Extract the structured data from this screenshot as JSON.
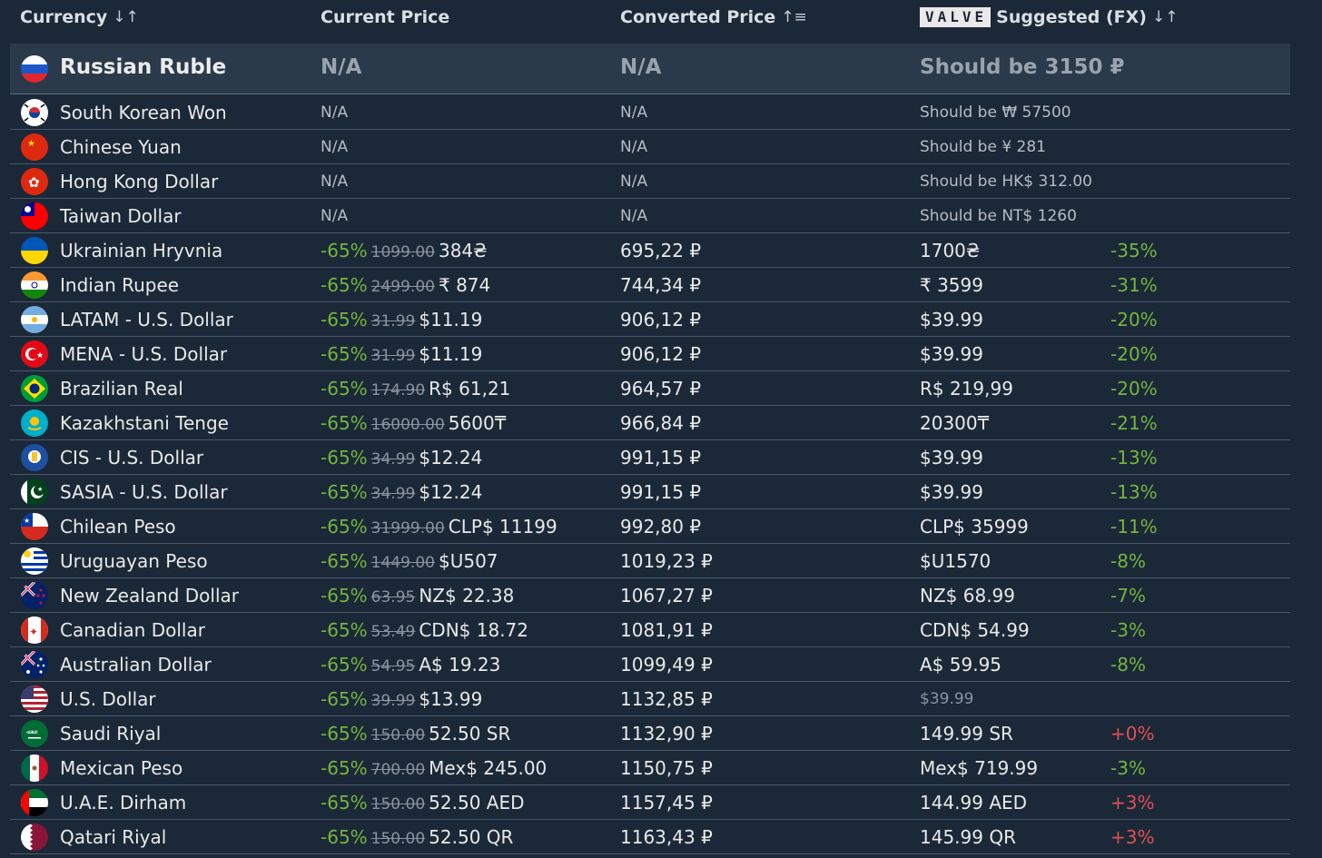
{
  "header": {
    "currency": "Currency",
    "current_price": "Current Price",
    "converted_price": "Converted Price",
    "valve_badge": "VALVE",
    "suggested": "Suggested (FX)"
  },
  "featured": {
    "name": "Russian Ruble",
    "current": "N/A",
    "converted": "N/A",
    "suggested": "Should be 3150 ₽"
  },
  "rows": [
    {
      "name": "South Korean Won",
      "flag": "kr",
      "na": true,
      "current": "N/A",
      "converted": "N/A",
      "suggested": "Should be ₩ 57500"
    },
    {
      "name": "Chinese Yuan",
      "flag": "cn",
      "na": true,
      "current": "N/A",
      "converted": "N/A",
      "suggested": "Should be ¥ 281"
    },
    {
      "name": "Hong Kong Dollar",
      "flag": "hk",
      "na": true,
      "current": "N/A",
      "converted": "N/A",
      "suggested": "Should be HK$ 312.00"
    },
    {
      "name": "Taiwan Dollar",
      "flag": "tw",
      "na": true,
      "current": "N/A",
      "converted": "N/A",
      "suggested": "Should be NT$ 1260"
    },
    {
      "name": "Ukrainian Hryvnia",
      "flag": "ua",
      "discount": "-65%",
      "original": "1099.00",
      "price": "384₴",
      "converted": "695,22 ₽",
      "suggested": "1700₴",
      "diff": "-35%",
      "diff_sign": "neg"
    },
    {
      "name": "Indian Rupee",
      "flag": "in",
      "discount": "-65%",
      "original": "2499.00",
      "price": "₹ 874",
      "converted": "744,34 ₽",
      "suggested": "₹ 3599",
      "diff": "-31%",
      "diff_sign": "neg"
    },
    {
      "name": "LATAM - U.S. Dollar",
      "flag": "ar",
      "discount": "-65%",
      "original": "31.99",
      "price": "$11.19",
      "converted": "906,12 ₽",
      "suggested": "$39.99",
      "diff": "-20%",
      "diff_sign": "neg"
    },
    {
      "name": "MENA - U.S. Dollar",
      "flag": "tr",
      "discount": "-65%",
      "original": "31.99",
      "price": "$11.19",
      "converted": "906,12 ₽",
      "suggested": "$39.99",
      "diff": "-20%",
      "diff_sign": "neg"
    },
    {
      "name": "Brazilian Real",
      "flag": "br",
      "discount": "-65%",
      "original": "174.90",
      "price": "R$ 61,21",
      "converted": "964,57 ₽",
      "suggested": "R$ 219,99",
      "diff": "-20%",
      "diff_sign": "neg"
    },
    {
      "name": "Kazakhstani Tenge",
      "flag": "kz",
      "discount": "-65%",
      "original": "16000.00",
      "price": "5600₸",
      "converted": "966,84 ₽",
      "suggested": "20300₸",
      "diff": "-21%",
      "diff_sign": "neg"
    },
    {
      "name": "CIS - U.S. Dollar",
      "flag": "cis",
      "discount": "-65%",
      "original": "34.99",
      "price": "$12.24",
      "converted": "991,15 ₽",
      "suggested": "$39.99",
      "diff": "-13%",
      "diff_sign": "neg"
    },
    {
      "name": "SASIA - U.S. Dollar",
      "flag": "pk",
      "discount": "-65%",
      "original": "34.99",
      "price": "$12.24",
      "converted": "991,15 ₽",
      "suggested": "$39.99",
      "diff": "-13%",
      "diff_sign": "neg"
    },
    {
      "name": "Chilean Peso",
      "flag": "cl",
      "discount": "-65%",
      "original": "31999.00",
      "price": "CLP$ 11199",
      "converted": "992,80 ₽",
      "suggested": "CLP$ 35999",
      "diff": "-11%",
      "diff_sign": "neg"
    },
    {
      "name": "Uruguayan Peso",
      "flag": "uy",
      "discount": "-65%",
      "original": "1449.00",
      "price": "$U507",
      "converted": "1019,23 ₽",
      "suggested": "$U1570",
      "diff": "-8%",
      "diff_sign": "neg"
    },
    {
      "name": "New Zealand Dollar",
      "flag": "nz",
      "discount": "-65%",
      "original": "63.95",
      "price": "NZ$ 22.38",
      "converted": "1067,27 ₽",
      "suggested": "NZ$ 68.99",
      "diff": "-7%",
      "diff_sign": "neg"
    },
    {
      "name": "Canadian Dollar",
      "flag": "ca",
      "discount": "-65%",
      "original": "53.49",
      "price": "CDN$ 18.72",
      "converted": "1081,91 ₽",
      "suggested": "CDN$ 54.99",
      "diff": "-3%",
      "diff_sign": "neg"
    },
    {
      "name": "Australian Dollar",
      "flag": "au",
      "discount": "-65%",
      "original": "54.95",
      "price": "A$ 19.23",
      "converted": "1099,49 ₽",
      "suggested": "A$ 59.95",
      "diff": "-8%",
      "diff_sign": "neg"
    },
    {
      "name": "U.S. Dollar",
      "flag": "us",
      "discount": "-65%",
      "original": "39.99",
      "price": "$13.99",
      "converted": "1132,85 ₽",
      "suggested": "$39.99",
      "diff": "",
      "diff_sign": "none",
      "suggested_muted": true
    },
    {
      "name": "Saudi Riyal",
      "flag": "sa",
      "discount": "-65%",
      "original": "150.00",
      "price": "52.50 SR",
      "converted": "1132,90 ₽",
      "suggested": "149.99 SR",
      "diff": "+0%",
      "diff_sign": "pos"
    },
    {
      "name": "Mexican Peso",
      "flag": "mx",
      "discount": "-65%",
      "original": "700.00",
      "price": "Mex$ 245.00",
      "converted": "1150,75 ₽",
      "suggested": "Mex$ 719.99",
      "diff": "-3%",
      "diff_sign": "neg"
    },
    {
      "name": "U.A.E. Dirham",
      "flag": "ae",
      "discount": "-65%",
      "original": "150.00",
      "price": "52.50 AED",
      "converted": "1157,45 ₽",
      "suggested": "144.99 AED",
      "diff": "+3%",
      "diff_sign": "pos"
    },
    {
      "name": "Qatari Riyal",
      "flag": "qa",
      "discount": "-65%",
      "original": "150.00",
      "price": "52.50 QR",
      "converted": "1163,43 ₽",
      "suggested": "145.99 QR",
      "diff": "+3%",
      "diff_sign": "pos"
    }
  ],
  "colors": {
    "background": "#1b2838",
    "featured_bg": "#2a3a4b",
    "discount_green": "#74b53e",
    "increase_red": "#e05050"
  }
}
